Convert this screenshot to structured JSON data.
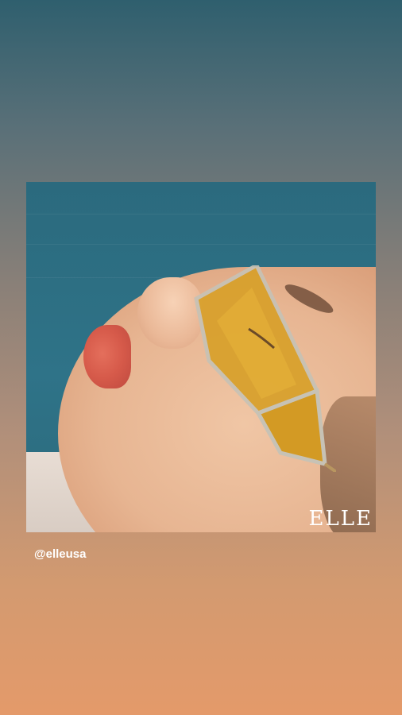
{
  "post": {
    "brand_logo": "ELLE"
  },
  "caption": {
    "handle": "@elleusa"
  }
}
